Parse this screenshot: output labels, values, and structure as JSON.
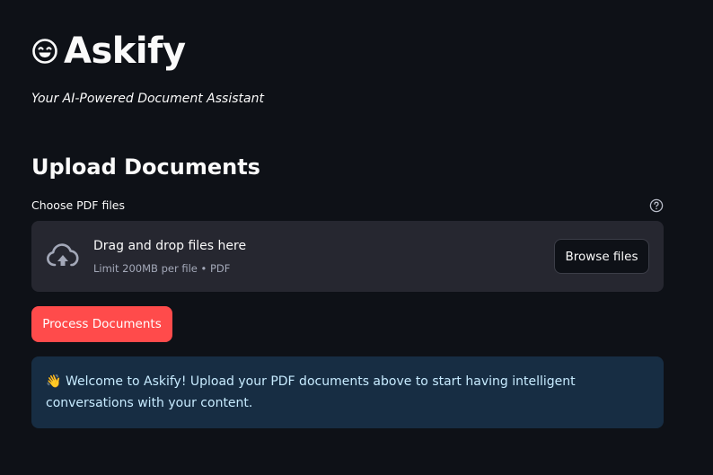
{
  "app": {
    "title": "Askify",
    "logo_icon": "smiling-face-icon",
    "subtitle": "Your AI-Powered Document Assistant"
  },
  "upload_section": {
    "heading": "Upload Documents",
    "uploader_label": "Choose PDF files",
    "help_icon": "question-circle-icon",
    "dropzone": {
      "icon": "cloud-upload-icon",
      "title": "Drag and drop files here",
      "limit_text": "Limit 200MB per file • PDF",
      "browse_label": "Browse files"
    },
    "process_label": "Process Documents"
  },
  "info_message": {
    "emoji": "👋",
    "text": "Welcome to Askify! Upload your PDF documents above to start having intelligent conversations with your content."
  },
  "colors": {
    "background": "#0e1117",
    "dropzone": "#262730",
    "primary": "#ff4b4b",
    "info_background": "#172d43",
    "info_text": "#c7ebff"
  }
}
